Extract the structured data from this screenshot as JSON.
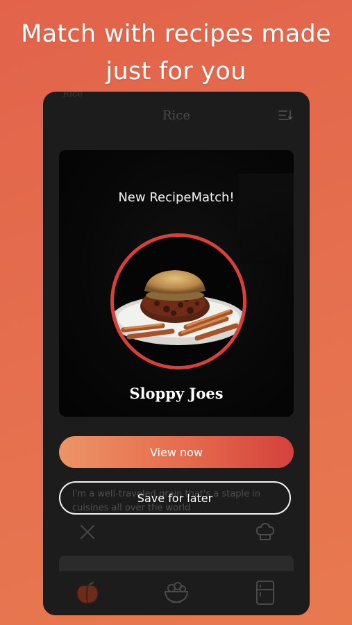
{
  "headline": "Match with recipes made just for you",
  "app": {
    "ghost_tab_label": "Rice",
    "title": "Rice"
  },
  "match_card": {
    "heading": "New RecipeMatch!",
    "dish_name": "Sloppy Joes"
  },
  "actions": {
    "view_now": "View now",
    "save_for_later": "Save for later"
  },
  "background_card": {
    "description": "I'm a well-traveled grain that's a staple in cuisines all over the world"
  },
  "bottom_nav": {
    "items": [
      "peach-icon",
      "salad-bowl-icon",
      "fridge-icon"
    ]
  },
  "colors": {
    "background_orange": "#e5704f",
    "phone_bg": "#1c1c1d",
    "accent_red": "#d9403a",
    "button_gradient_start": "#ec9466",
    "button_gradient_end": "#d4413c"
  }
}
